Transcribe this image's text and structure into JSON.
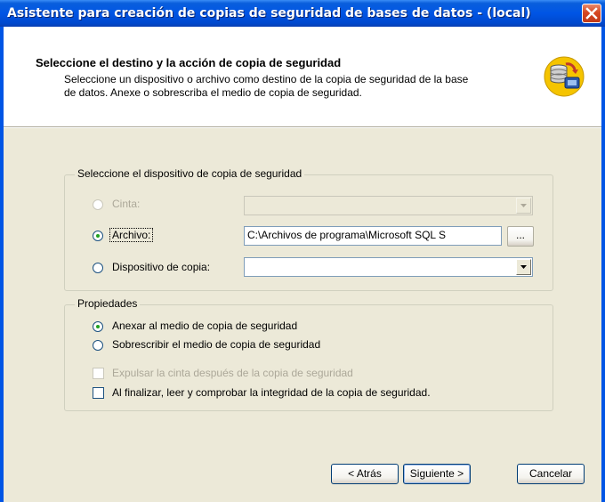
{
  "window": {
    "title": "Asistente para creación de copias de seguridad de bases de datos - (local)"
  },
  "header": {
    "title": "Seleccione el destino y la acción de copia de seguridad",
    "description": "Seleccione un dispositivo o archivo como destino de la copia de seguridad de la base de datos. Anexe o sobrescriba el medio de copia de seguridad."
  },
  "device_group": {
    "label": "Seleccione el dispositivo de copia de seguridad",
    "options": [
      {
        "label": "Cinta:",
        "selected": false,
        "enabled": false,
        "value": ""
      },
      {
        "label": "Archivo:",
        "selected": true,
        "enabled": true,
        "value": "C:\\Archivos de programa\\Microsoft SQL S"
      },
      {
        "label": "Dispositivo de copia:",
        "selected": false,
        "enabled": true,
        "value": ""
      }
    ],
    "browse_label": "..."
  },
  "properties_group": {
    "label": "Propiedades",
    "radios": [
      {
        "label": "Anexar al medio de copia de seguridad",
        "selected": true
      },
      {
        "label": "Sobrescribir el medio de copia de seguridad",
        "selected": false
      }
    ],
    "checkboxes": [
      {
        "label": "Expulsar la cinta después de la copia de seguridad",
        "checked": false,
        "enabled": false
      },
      {
        "label": "Al finalizar, leer y comprobar la integridad de la copia de seguridad.",
        "checked": false,
        "enabled": true
      }
    ]
  },
  "buttons": {
    "back": "< Atrás",
    "next": "Siguiente >",
    "cancel": "Cancelar"
  },
  "icons": {
    "close": "close-icon",
    "wizard": "database-backup-icon",
    "dropdown": "chevron-down-icon"
  },
  "colors": {
    "titlebar": "#0055e5",
    "dialog_bg": "#ece9d8",
    "radio_dot": "#21a121"
  }
}
